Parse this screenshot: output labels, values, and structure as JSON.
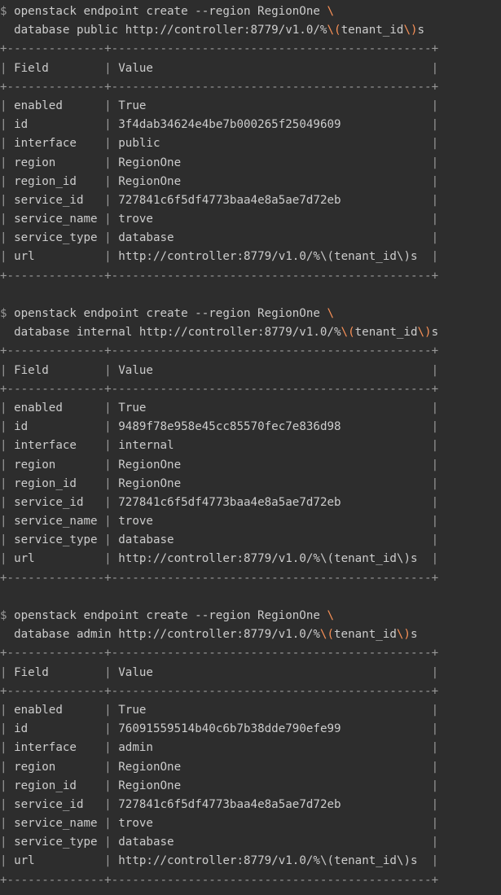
{
  "colors": {
    "background": "#2d2d2d",
    "text": "#cccccc",
    "border": "#999999",
    "highlight": "#f99157"
  },
  "prompt": "$ ",
  "table_border": "+--------------+----------------------------------------------+",
  "header": {
    "field": "Field",
    "value": "Value"
  },
  "blocks": [
    {
      "cmd_line1": "openstack endpoint create --region RegionOne ",
      "cmd_line1_cont": "\\",
      "cmd_line2_pre": "  database public http://controller:8779/v1.0/%",
      "cmd_line2_hl1": "\\(",
      "cmd_line2_mid": "tenant_id",
      "cmd_line2_hl2": "\\)",
      "cmd_line2_post": "s",
      "rows": [
        {
          "field": "enabled",
          "value": "True"
        },
        {
          "field": "id",
          "value": "3f4dab34624e4be7b000265f25049609"
        },
        {
          "field": "interface",
          "value": "public"
        },
        {
          "field": "region",
          "value": "RegionOne"
        },
        {
          "field": "region_id",
          "value": "RegionOne"
        },
        {
          "field": "service_id",
          "value": "727841c6f5df4773baa4e8a5ae7d72eb"
        },
        {
          "field": "service_name",
          "value": "trove"
        },
        {
          "field": "service_type",
          "value": "database"
        },
        {
          "field": "url",
          "value": "http://controller:8779/v1.0/%\\(tenant_id\\)s"
        }
      ]
    },
    {
      "cmd_line1": "openstack endpoint create --region RegionOne ",
      "cmd_line1_cont": "\\",
      "cmd_line2_pre": "  database internal http://controller:8779/v1.0/%",
      "cmd_line2_hl1": "\\(",
      "cmd_line2_mid": "tenant_id",
      "cmd_line2_hl2": "\\)",
      "cmd_line2_post": "s",
      "rows": [
        {
          "field": "enabled",
          "value": "True"
        },
        {
          "field": "id",
          "value": "9489f78e958e45cc85570fec7e836d98"
        },
        {
          "field": "interface",
          "value": "internal"
        },
        {
          "field": "region",
          "value": "RegionOne"
        },
        {
          "field": "region_id",
          "value": "RegionOne"
        },
        {
          "field": "service_id",
          "value": "727841c6f5df4773baa4e8a5ae7d72eb"
        },
        {
          "field": "service_name",
          "value": "trove"
        },
        {
          "field": "service_type",
          "value": "database"
        },
        {
          "field": "url",
          "value": "http://controller:8779/v1.0/%\\(tenant_id\\)s"
        }
      ]
    },
    {
      "cmd_line1": "openstack endpoint create --region RegionOne ",
      "cmd_line1_cont": "\\",
      "cmd_line2_pre": "  database admin http://controller:8779/v1.0/%",
      "cmd_line2_hl1": "\\(",
      "cmd_line2_mid": "tenant_id",
      "cmd_line2_hl2": "\\)",
      "cmd_line2_post": "s",
      "rows": [
        {
          "field": "enabled",
          "value": "True"
        },
        {
          "field": "id",
          "value": "76091559514b40c6b7b38dde790efe99"
        },
        {
          "field": "interface",
          "value": "admin"
        },
        {
          "field": "region",
          "value": "RegionOne"
        },
        {
          "field": "region_id",
          "value": "RegionOne"
        },
        {
          "field": "service_id",
          "value": "727841c6f5df4773baa4e8a5ae7d72eb"
        },
        {
          "field": "service_name",
          "value": "trove"
        },
        {
          "field": "service_type",
          "value": "database"
        },
        {
          "field": "url",
          "value": "http://controller:8779/v1.0/%\\(tenant_id\\)s"
        }
      ]
    }
  ]
}
